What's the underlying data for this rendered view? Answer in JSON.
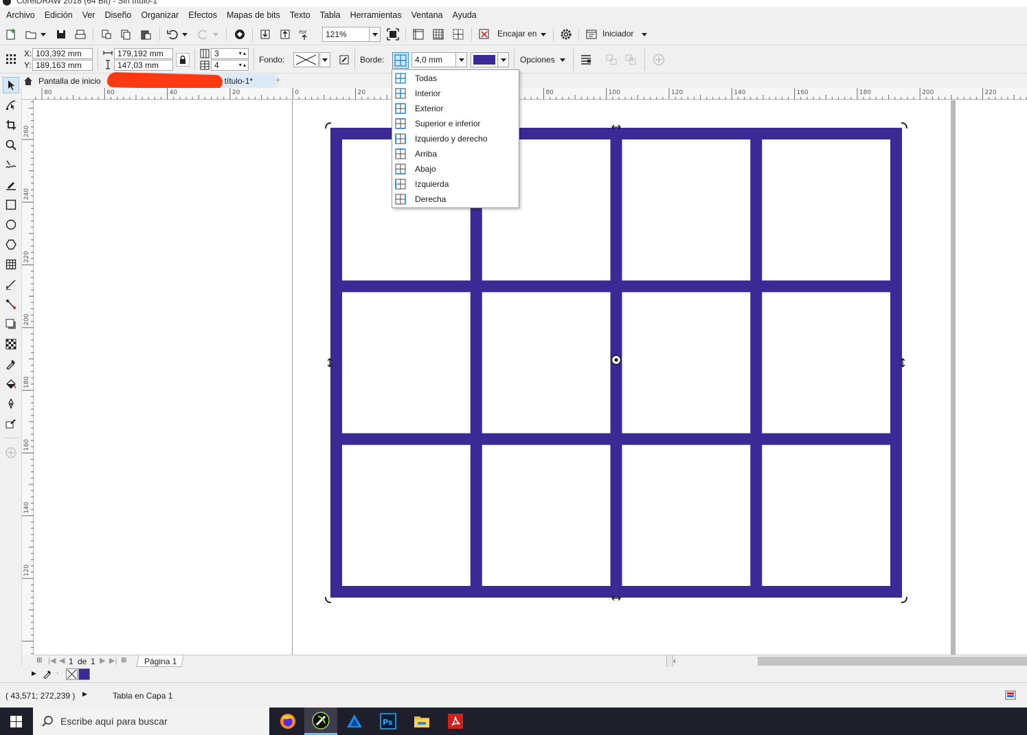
{
  "window": {
    "title": "CorelDRAW 2018 (64 Bit) - Sin título-1"
  },
  "menu": [
    "Archivo",
    "Edición",
    "Ver",
    "Diseño",
    "Organizar",
    "Efectos",
    "Mapas de bits",
    "Texto",
    "Tabla",
    "Herramientas",
    "Ventana",
    "Ayuda"
  ],
  "toolbar": {
    "zoom": "121%",
    "snap_label": "Encajar en",
    "launcher_label": "Iniciador"
  },
  "properties": {
    "x_label": "X:",
    "x_value": "103,392 mm",
    "y_label": "Y:",
    "y_value": "189,163 mm",
    "width_value": "179,192 mm",
    "height_value": "147,03 mm",
    "rows": "3",
    "columns": "4",
    "fill_label": "Fondo:",
    "border_label": "Borde:",
    "border_width": "4,0 mm",
    "border_color": "#3a2a96",
    "options_label": "Opciones"
  },
  "tabs": {
    "home": "Pantalla de inicio",
    "document": "Sin título-1*"
  },
  "border_menu": [
    "Todas",
    "Interior",
    "Exterior",
    "Superior e inferior",
    "Izquierdo y derecho",
    "Arriba",
    "Abajo",
    "Izquierda",
    "Derecha"
  ],
  "ruler_h_labels": [
    "80",
    "60",
    "40",
    "20",
    "0",
    "20",
    "40",
    "60",
    "80",
    "100",
    "120",
    "140",
    "160",
    "180",
    "200",
    "220"
  ],
  "ruler_v_labels": [
    "260",
    "240",
    "220",
    "200",
    "180",
    "160",
    "140",
    "120"
  ],
  "table": {
    "rows": 3,
    "columns": 4,
    "color": "#3a2a96"
  },
  "page_nav": {
    "current": "1",
    "of_label": "de",
    "total": "1",
    "page_tab": "Página 1"
  },
  "status": {
    "coords": "( 43,571; 272,239 )",
    "object_info": "Tabla en Capa 1"
  },
  "taskbar": {
    "search_placeholder": "Escribe aquí para buscar"
  }
}
